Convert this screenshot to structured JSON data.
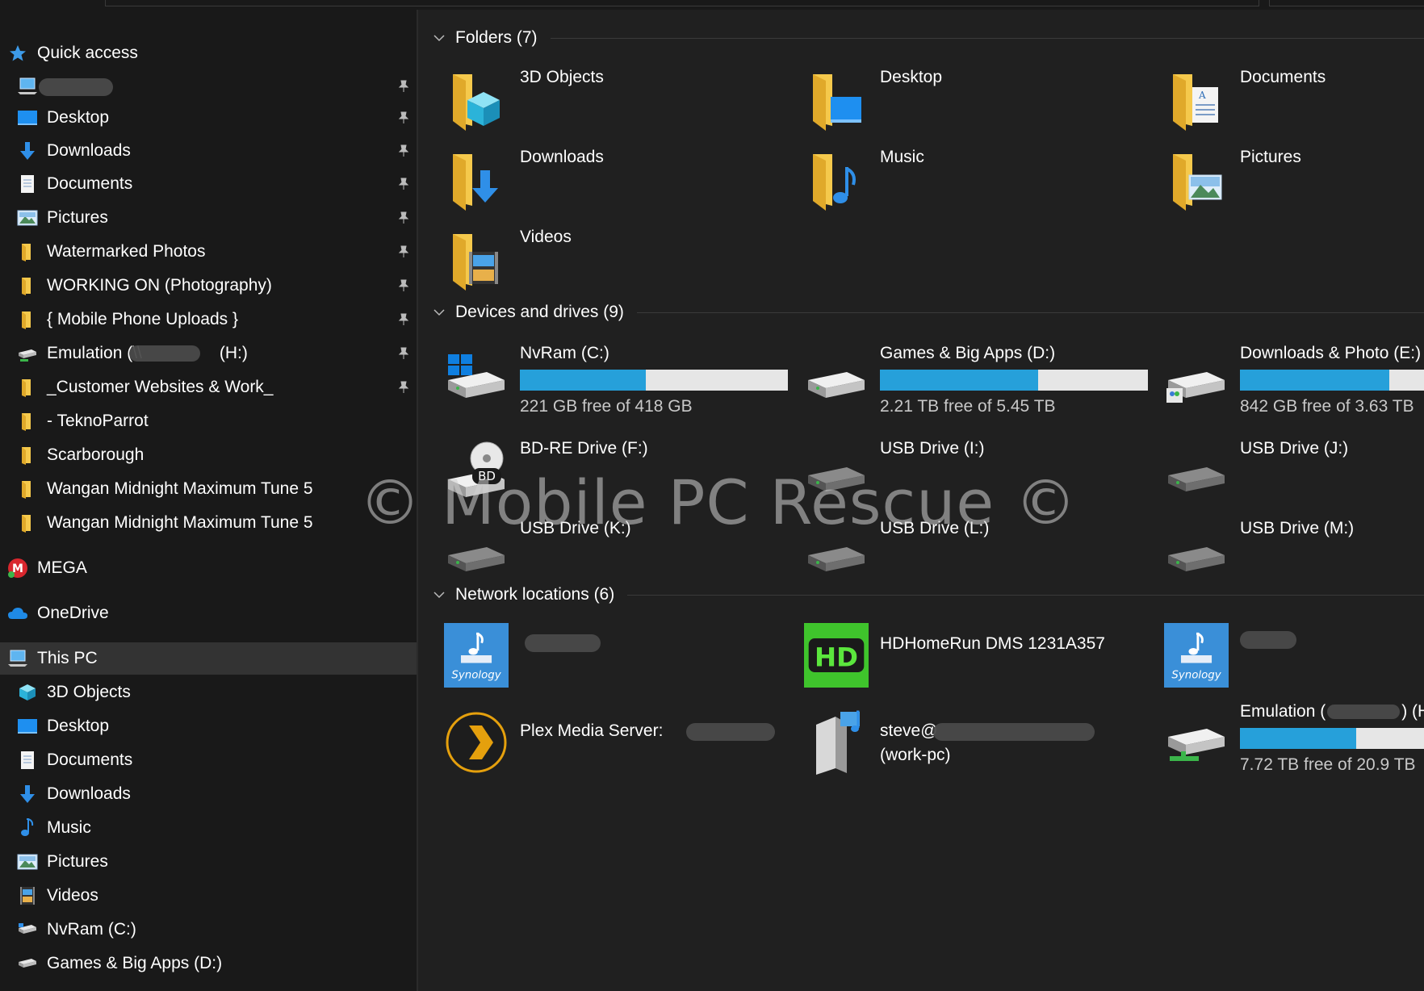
{
  "colors": {
    "bg": "#202020",
    "nav_bg": "#191919",
    "accent": "#26a0da",
    "folder": "#f5c94c"
  },
  "nav": {
    "quick_access": {
      "label": "Quick access",
      "items": [
        {
          "label": "",
          "icon": "computer-icon",
          "pinned": true,
          "redacted": true
        },
        {
          "label": "Desktop",
          "icon": "desktop-icon",
          "pinned": true
        },
        {
          "label": "Downloads",
          "icon": "download-arrow-icon",
          "pinned": true
        },
        {
          "label": "Documents",
          "icon": "document-icon",
          "pinned": true
        },
        {
          "label": "Pictures",
          "icon": "pictures-icon",
          "pinned": true
        },
        {
          "label": "Watermarked Photos",
          "icon": "folder-icon",
          "pinned": true
        },
        {
          "label": "WORKING ON (Photography)",
          "icon": "folder-icon",
          "pinned": true
        },
        {
          "label": "{ Mobile Phone Uploads }",
          "icon": "folder-icon",
          "pinned": true
        },
        {
          "label": "Emulation (\\\\",
          "label_tail": "(H:)",
          "icon": "network-drive-icon",
          "pinned": true,
          "redacted": true
        },
        {
          "label": "_Customer Websites & Work_",
          "icon": "folder-icon",
          "pinned": true
        },
        {
          "label": "- TeknoParrot",
          "icon": "folder-icon",
          "pinned": false
        },
        {
          "label": "Scarborough",
          "icon": "folder-icon",
          "pinned": false
        },
        {
          "label": "Wangan Midnight Maximum Tune 5",
          "icon": "folder-icon",
          "pinned": false
        },
        {
          "label": "Wangan Midnight Maximum Tune 5",
          "icon": "folder-icon",
          "pinned": false
        }
      ]
    },
    "mega": "MEGA",
    "onedrive": "OneDrive",
    "this_pc": {
      "label": "This PC",
      "items": [
        {
          "label": "3D Objects",
          "icon": "cube-icon"
        },
        {
          "label": "Desktop",
          "icon": "desktop-icon"
        },
        {
          "label": "Documents",
          "icon": "document-icon"
        },
        {
          "label": "Downloads",
          "icon": "download-arrow-icon"
        },
        {
          "label": "Music",
          "icon": "music-note-icon"
        },
        {
          "label": "Pictures",
          "icon": "pictures-icon"
        },
        {
          "label": "Videos",
          "icon": "film-icon"
        },
        {
          "label": "NvRam (C:)",
          "icon": "drive-icon"
        },
        {
          "label": "Games & Big Apps (D:)",
          "icon": "drive-icon"
        }
      ]
    }
  },
  "folders": {
    "header": "Folders (7)",
    "items": [
      {
        "label": "3D Objects",
        "icon": "folder-3d-objects-icon"
      },
      {
        "label": "Desktop",
        "icon": "folder-desktop-icon"
      },
      {
        "label": "Documents",
        "icon": "folder-documents-icon"
      },
      {
        "label": "Downloads",
        "icon": "folder-downloads-icon"
      },
      {
        "label": "Music",
        "icon": "folder-music-icon"
      },
      {
        "label": "Pictures",
        "icon": "folder-pictures-icon"
      },
      {
        "label": "Videos",
        "icon": "folder-videos-icon"
      }
    ]
  },
  "drives": {
    "header": "Devices and drives (9)",
    "items": [
      {
        "label": "NvRam (C:)",
        "free": "221 GB free of 418 GB",
        "used_fraction": 0.47,
        "icon": "windows-drive-icon"
      },
      {
        "label": "Games & Big Apps (D:)",
        "free": "2.21 TB free of 5.45 TB",
        "used_fraction": 0.59,
        "icon": "drive-icon"
      },
      {
        "label": "Downloads & Photo (E:)",
        "free": "842 GB free of 3.63 TB",
        "used_fraction": 0.77,
        "icon": "shared-drive-icon"
      },
      {
        "label": "BD-RE Drive (F:)",
        "icon": "bd-drive-icon",
        "badge": "BD"
      },
      {
        "label": "USB Drive (I:)",
        "icon": "usb-drive-icon"
      },
      {
        "label": "USB Drive (J:)",
        "icon": "usb-drive-icon"
      },
      {
        "label": "USB Drive (K:)",
        "icon": "usb-drive-icon"
      },
      {
        "label": "USB Drive (L:)",
        "icon": "usb-drive-icon"
      },
      {
        "label": "USB Drive (M:)",
        "icon": "usb-drive-icon"
      }
    ]
  },
  "network": {
    "header": "Network locations (6)",
    "items": [
      {
        "label": "",
        "icon": "synology-media-icon",
        "brand": "Synology",
        "redacted": true
      },
      {
        "label": "HDHomeRun DMS 1231A357",
        "icon": "hdhomerun-icon",
        "badge": "HD"
      },
      {
        "label": "",
        "icon": "synology-media-icon",
        "brand": "Synology",
        "redacted": true
      },
      {
        "label": "Plex Media Server:",
        "icon": "plex-icon",
        "redacted": true
      },
      {
        "label": "steve@",
        "label2": "(work-pc)",
        "icon": "media-server-icon",
        "redacted": true
      },
      {
        "label": "Emulation (",
        "label_tail": ") (H:)",
        "free": "7.72 TB free of 20.9 TB",
        "used_fraction": 0.63,
        "icon": "network-drive-icon",
        "redacted": true
      }
    ]
  },
  "watermark": "© Mobile PC Rescue ©"
}
